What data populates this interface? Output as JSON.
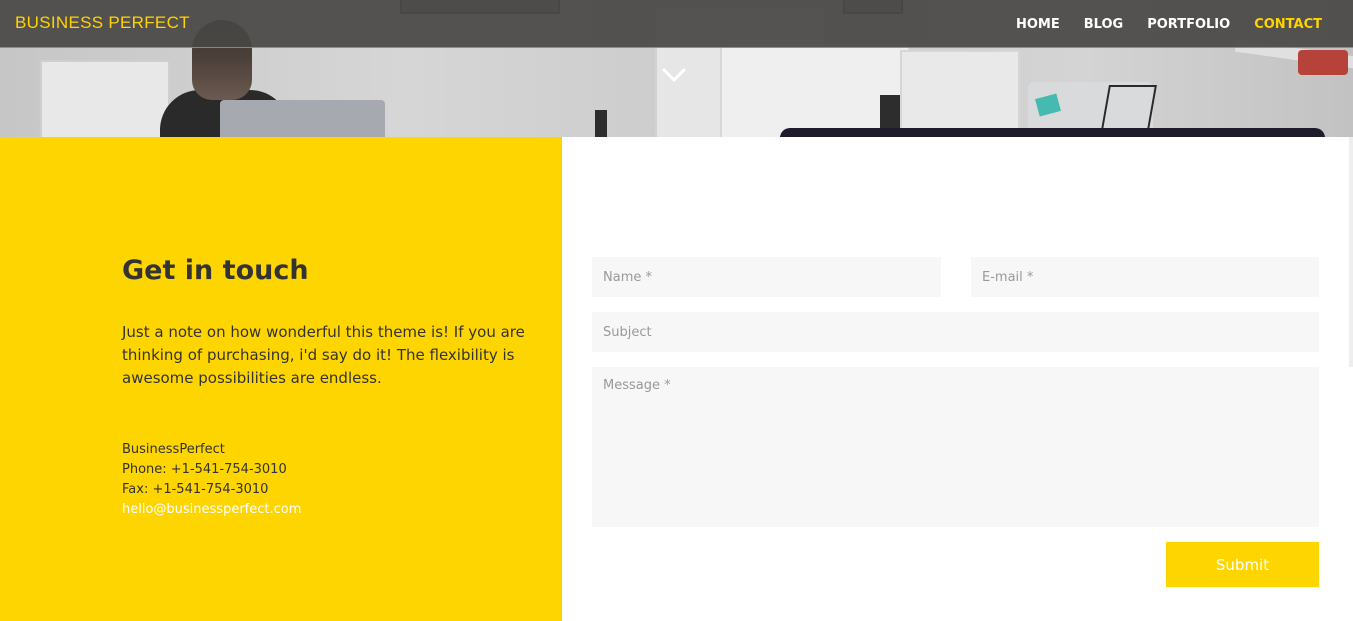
{
  "brand": "BUSINESS PERFECT",
  "nav": [
    {
      "label": "HOME",
      "active": false
    },
    {
      "label": "BLOG",
      "active": false
    },
    {
      "label": "PORTFOLIO",
      "active": false
    },
    {
      "label": "CONTACT",
      "active": true
    }
  ],
  "contact_info": {
    "heading": "Get in touch",
    "lead": "Just a note on how wonderful this theme is! If you are thinking of purchasing, i'd say do it! The flexibility is awesome possibilities are endless.",
    "company": "BusinessPerfect",
    "phone": "Phone: +1-541-754-3010",
    "fax": "Fax: +1-541-754-3010",
    "email": "hello@businessperfect.com"
  },
  "form": {
    "name_placeholder": "Name *",
    "email_placeholder": "E-mail *",
    "subject_placeholder": "Subject",
    "message_placeholder": "Message *",
    "submit_label": "Submit"
  },
  "colors": {
    "accent": "#ffd500",
    "navbar": "#484644",
    "text": "#333333"
  },
  "icons": {
    "scroll_down": "chevron-down-icon"
  }
}
